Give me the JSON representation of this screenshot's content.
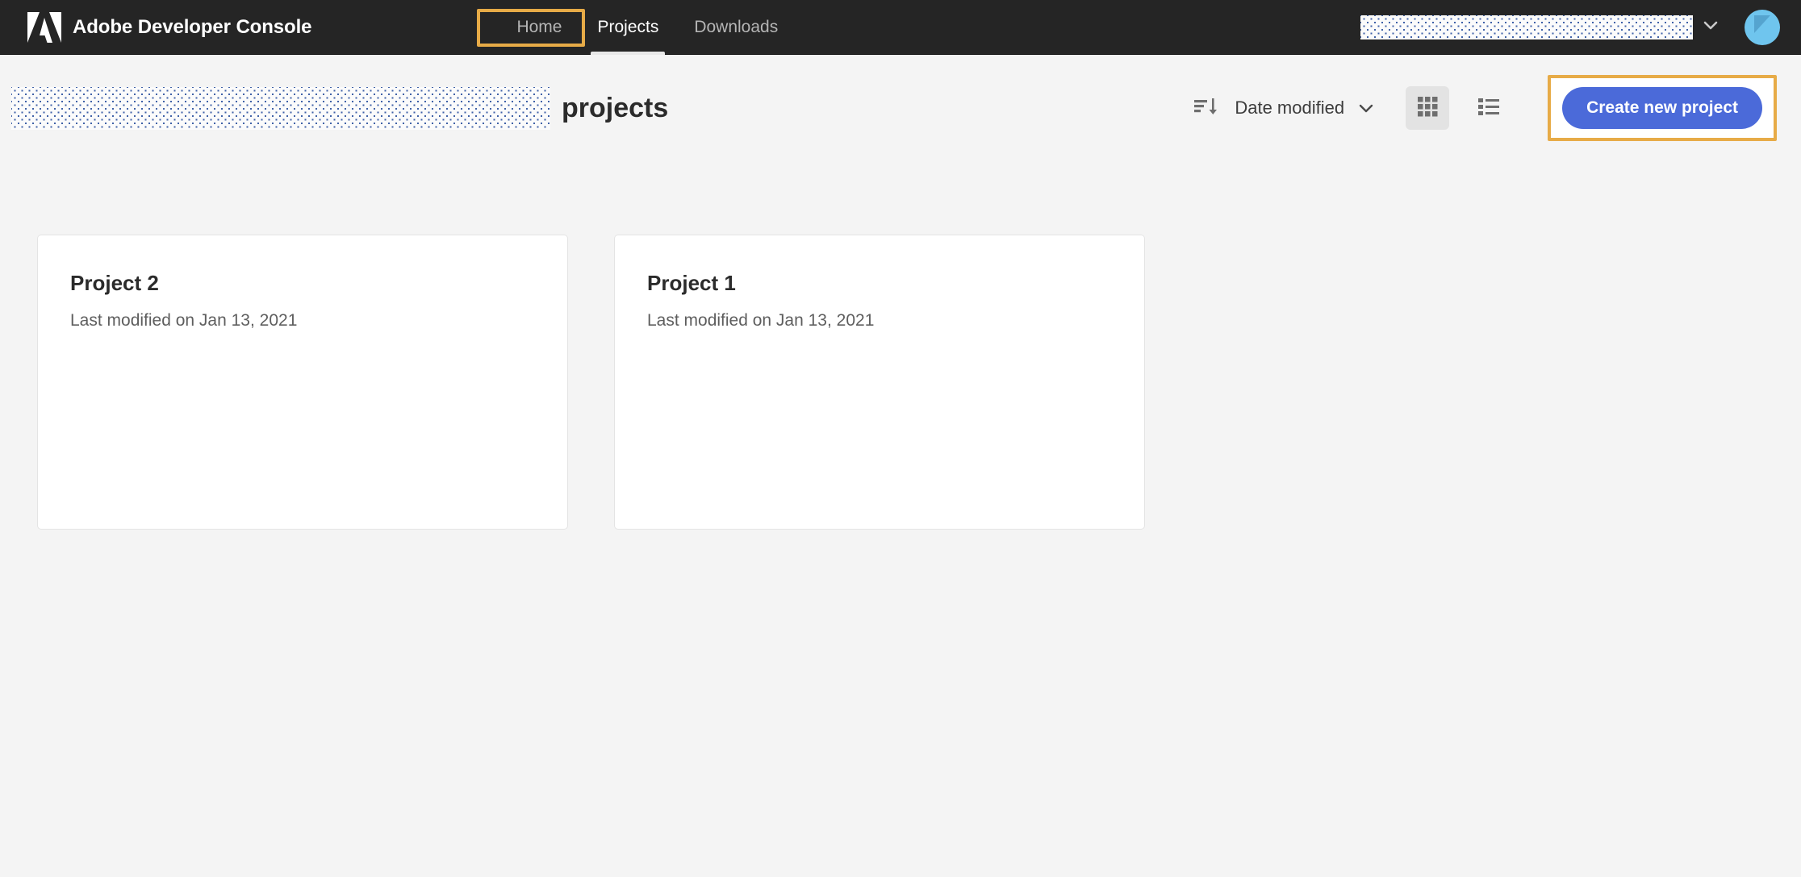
{
  "header": {
    "brand_title": "Adobe Developer Console",
    "logo_icon": "adobe-logo-icon",
    "nav": [
      {
        "label": "Home",
        "active": false
      },
      {
        "label": "Projects",
        "active": true,
        "highlighted": true
      },
      {
        "label": "Downloads",
        "active": false
      }
    ],
    "org_selector": {
      "value": "",
      "redacted": true,
      "chevron_icon": "chevron-down-icon"
    },
    "avatar_icon": "user-avatar-icon",
    "background_color": "#252525",
    "highlight_color": "#e7ab47"
  },
  "toolbar": {
    "org_name_redacted": true,
    "page_title": "projects",
    "sort_icon": "sort-descending-icon",
    "sort_by_label": "Date modified",
    "sort_chevron_icon": "chevron-down-icon",
    "grid_view_icon": "grid-view-icon",
    "list_view_icon": "list-view-icon",
    "active_view": "grid",
    "create_button_label": "Create new project",
    "create_button_color": "#4b6ad9",
    "create_button_highlighted": true
  },
  "projects": [
    {
      "name": "Project 2",
      "modified": "Last modified on Jan 13, 2021"
    },
    {
      "name": "Project 1",
      "modified": "Last modified on Jan 13, 2021"
    }
  ],
  "theme": {
    "page_background": "#f4f4f4",
    "card_background": "#ffffff",
    "accent_blue": "#4b6ad9",
    "highlight_amber": "#e7ab47"
  }
}
